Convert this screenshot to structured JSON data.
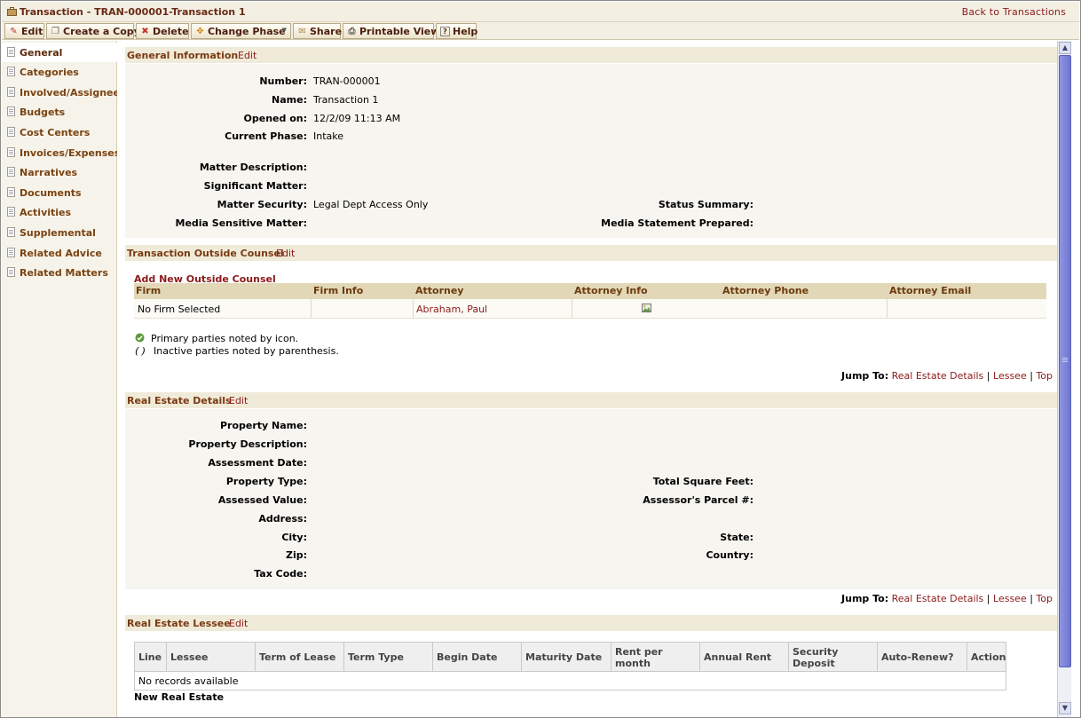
{
  "window": {
    "title": "Transaction - TRAN-000001-Transaction 1",
    "back_link": "Back to Transactions"
  },
  "toolbar": {
    "edit": "Edit",
    "copy": "Create a Copy",
    "delete": "Delete",
    "change_phase": "Change Phase",
    "share": "Share",
    "printable": "Printable View",
    "help": "Help"
  },
  "sidebar": {
    "items": [
      {
        "label": "General"
      },
      {
        "label": "Categories"
      },
      {
        "label": "Involved/Assignees"
      },
      {
        "label": "Budgets"
      },
      {
        "label": "Cost Centers"
      },
      {
        "label": "Invoices/Expenses"
      },
      {
        "label": "Narratives"
      },
      {
        "label": "Documents"
      },
      {
        "label": "Activities"
      },
      {
        "label": "Supplemental"
      },
      {
        "label": "Related Advice"
      },
      {
        "label": "Related Matters"
      }
    ]
  },
  "general": {
    "heading": "General Information",
    "edit": "Edit",
    "labels": {
      "number": "Number:",
      "name": "Name:",
      "opened": "Opened on:",
      "phase": "Current Phase:",
      "description": "Matter Description:",
      "significant": "Significant Matter:",
      "security": "Matter Security:",
      "media_sensitive": "Media Sensitive Matter:",
      "status_summary": "Status Summary:",
      "media_statement": "Media Statement Prepared:"
    },
    "values": {
      "number": "TRAN-000001",
      "name": "Transaction 1",
      "opened": "12/2/09 11:13 AM",
      "phase": "Intake",
      "security": "Legal Dept Access Only"
    }
  },
  "counsel": {
    "heading": "Transaction Outside Counsel",
    "edit": "Edit",
    "add_link": "Add New Outside Counsel",
    "columns": [
      "Firm",
      "Firm Info",
      "Attorney",
      "Attorney Info",
      "Attorney Phone",
      "Attorney Email"
    ],
    "row": {
      "firm": "No Firm Selected",
      "attorney": "Abraham, Paul"
    },
    "note_primary": "Primary parties noted by icon.",
    "note_inactive_symbol": "( )",
    "note_inactive": "Inactive parties noted by parenthesis."
  },
  "jump": {
    "label": "Jump To:",
    "real_estate": "Real Estate Details",
    "lessee": "Lessee",
    "top": "Top",
    "sep": "|"
  },
  "real_estate": {
    "heading": "Real Estate Details",
    "edit": "Edit",
    "labels": {
      "property_name": "Property Name:",
      "property_description": "Property Description:",
      "assessment_date": "Assessment Date:",
      "property_type": "Property Type:",
      "assessed_value": "Assessed Value:",
      "address": "Address:",
      "city": "City:",
      "zip": "Zip:",
      "tax_code": "Tax Code:",
      "total_sqft": "Total Square Feet:",
      "parcel": "Assessor's Parcel #:",
      "state": "State:",
      "country": "Country:"
    }
  },
  "lessee": {
    "heading": "Real Estate Lessee",
    "edit": "Edit",
    "columns": [
      "Line",
      "Lessee",
      "Term of Lease",
      "Term Type",
      "Begin Date",
      "Maturity Date",
      "Rent per month",
      "Annual Rent",
      "Security Deposit",
      "Auto-Renew?",
      "Action"
    ],
    "empty": "No records available",
    "new_link": "New Real Estate"
  }
}
